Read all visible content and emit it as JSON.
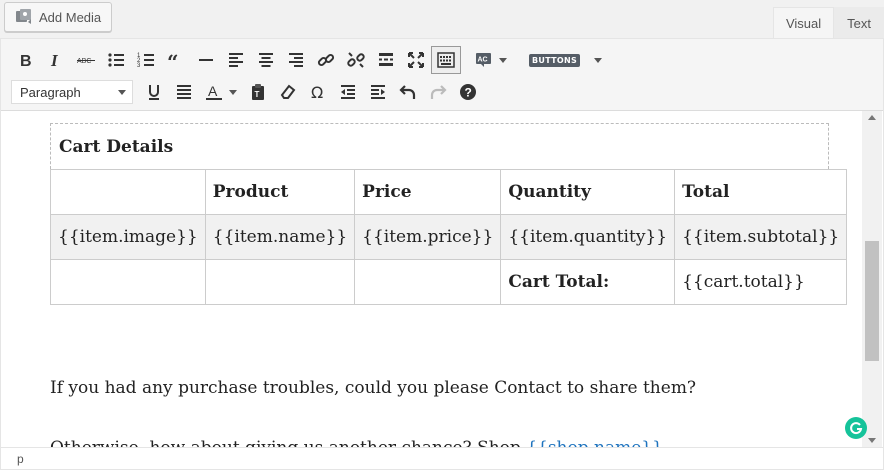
{
  "top": {
    "add_media_label": "Add Media",
    "tabs": [
      {
        "label": "Visual",
        "active": true
      },
      {
        "label": "Text",
        "active": false
      }
    ]
  },
  "toolbar": {
    "row1": [
      "bold-icon",
      "italic-icon",
      "strikethrough-icon",
      "bullet-list-icon",
      "numbered-list-icon",
      "blockquote-icon",
      "horizontal-rule-icon",
      "align-left-icon",
      "align-center-icon",
      "align-right-icon",
      "link-icon",
      "unlink-icon",
      "read-more-icon",
      "fullscreen-icon",
      "toolbar-toggle-icon",
      "spellcheck-icon",
      "buttons-icon"
    ],
    "buttons_badge": "BUTTONS",
    "format_select_value": "Paragraph",
    "row2": [
      "underline-icon",
      "justify-icon",
      "text-color-icon",
      "paste-text-icon",
      "clear-formatting-icon",
      "special-character-icon",
      "outdent-icon",
      "indent-icon",
      "undo-icon",
      "redo-icon",
      "help-icon"
    ]
  },
  "content": {
    "cart_title": "Cart Details",
    "table": {
      "header": [
        "",
        "Product",
        "Price",
        "Quantity",
        "Total"
      ],
      "item_row": [
        "{{item.image}}",
        "{{item.name}}",
        "{{item.price}}",
        "{{item.quantity}}",
        "{{item.subtotal}}"
      ],
      "total_row": [
        "",
        "",
        "",
        "Cart Total:",
        "{{cart.total}}"
      ]
    },
    "para1": "If you had any purchase troubles, could you please Contact to share them?",
    "para2_before": "Otherwise, how about giving us another chance? Shop ",
    "para2_link": "{{shop.name}}",
    "para2_after": "."
  },
  "status": {
    "path": "p"
  },
  "colors": {
    "link": "#1e73be",
    "grammarly": "#15c39a"
  }
}
